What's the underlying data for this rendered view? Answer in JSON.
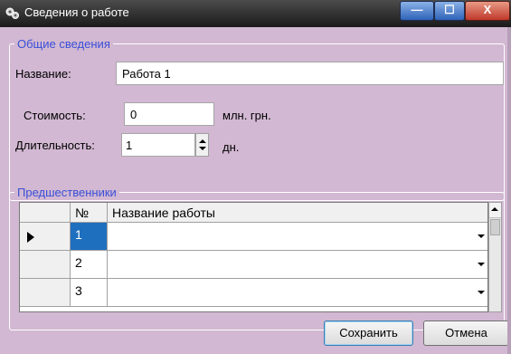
{
  "window": {
    "title": "Сведения о работе",
    "min_glyph": "—",
    "max_glyph": "☐",
    "close_glyph": "X"
  },
  "general": {
    "legend": "Общие сведения",
    "name_label": "Название:",
    "name_value": "Работа 1",
    "cost_label": "Стоимость:",
    "cost_value": "0",
    "cost_unit": "млн. грн.",
    "duration_label": "Длительность:",
    "duration_value": "1",
    "duration_unit": "дн."
  },
  "predecessors": {
    "legend": "Предшественники",
    "columns": {
      "num": "№",
      "name": "Название работы"
    },
    "rows": [
      {
        "num": "1",
        "name": ""
      },
      {
        "num": "2",
        "name": ""
      },
      {
        "num": "3",
        "name": ""
      }
    ]
  },
  "buttons": {
    "save": "Сохранить",
    "cancel": "Отмена"
  },
  "colors": {
    "client_bg": "#d2b8d2",
    "legend_text": "#3a4fd8",
    "selected_cell": "#1f6fbf"
  }
}
